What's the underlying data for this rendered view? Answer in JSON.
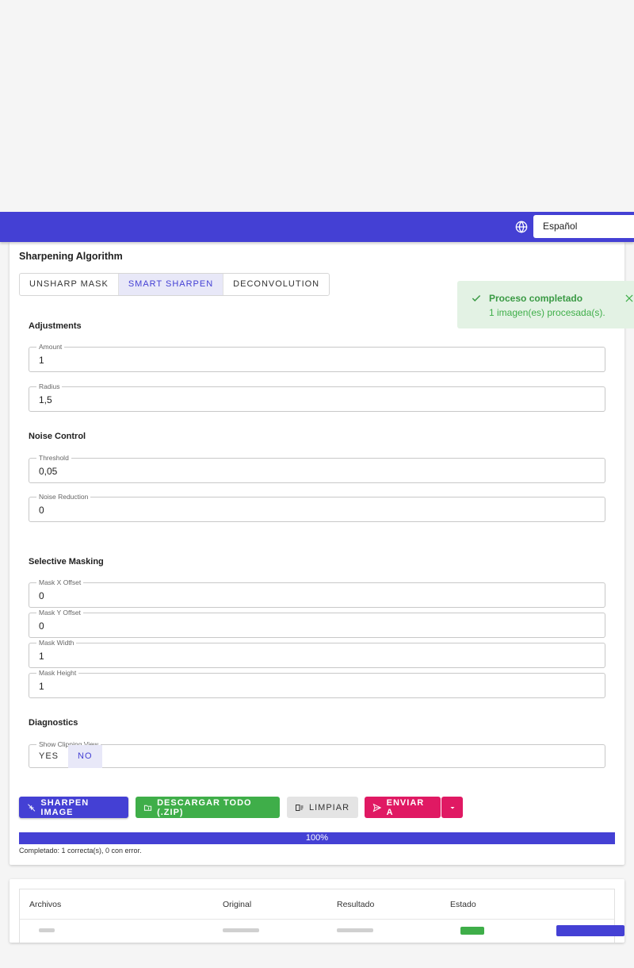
{
  "header": {
    "language_value": "Español"
  },
  "algorithm": {
    "title": "Sharpening Algorithm",
    "tabs": [
      {
        "label": "UNSHARP MASK",
        "active": false
      },
      {
        "label": "SMART SHARPEN",
        "active": true
      },
      {
        "label": "DECONVOLUTION",
        "active": false
      }
    ]
  },
  "adjustments": {
    "title": "Adjustments",
    "amount": {
      "label": "Amount",
      "value": "1"
    },
    "radius": {
      "label": "Radius",
      "value": "1,5"
    }
  },
  "noise": {
    "title": "Noise Control",
    "threshold": {
      "label": "Threshold",
      "value": "0,05"
    },
    "noise_reduction": {
      "label": "Noise Reduction",
      "value": "0"
    }
  },
  "masking": {
    "title": "Selective Masking",
    "x_offset": {
      "label": "Mask X Offset",
      "value": "0"
    },
    "y_offset": {
      "label": "Mask Y Offset",
      "value": "0"
    },
    "width": {
      "label": "Mask Width",
      "value": "1"
    },
    "height": {
      "label": "Mask Height",
      "value": "1"
    }
  },
  "diagnostics": {
    "title": "Diagnostics",
    "clipping": {
      "label": "Show Clipping View",
      "yes": "YES",
      "no": "NO",
      "selected": "NO"
    }
  },
  "actions": {
    "sharpen": "SHARPEN IMAGE",
    "download_all": "DESCARGAR TODO (.ZIP)",
    "clear": "LIMPIAR",
    "send_to": "ENVIAR A"
  },
  "progress": {
    "percent": 100,
    "label": "100%",
    "note": "Completado: 1 correcta(s), 0 con error."
  },
  "files_table": {
    "headers": [
      "Archivos",
      "Original",
      "Resultado",
      "Estado"
    ]
  },
  "toast": {
    "title": "Proceso completado",
    "message": "1 imagen(es) procesada(s)."
  },
  "colors": {
    "primary": "#4440d4",
    "success": "#3fae49",
    "accent": "#e01963",
    "toast_bg": "#e3f2e4"
  }
}
